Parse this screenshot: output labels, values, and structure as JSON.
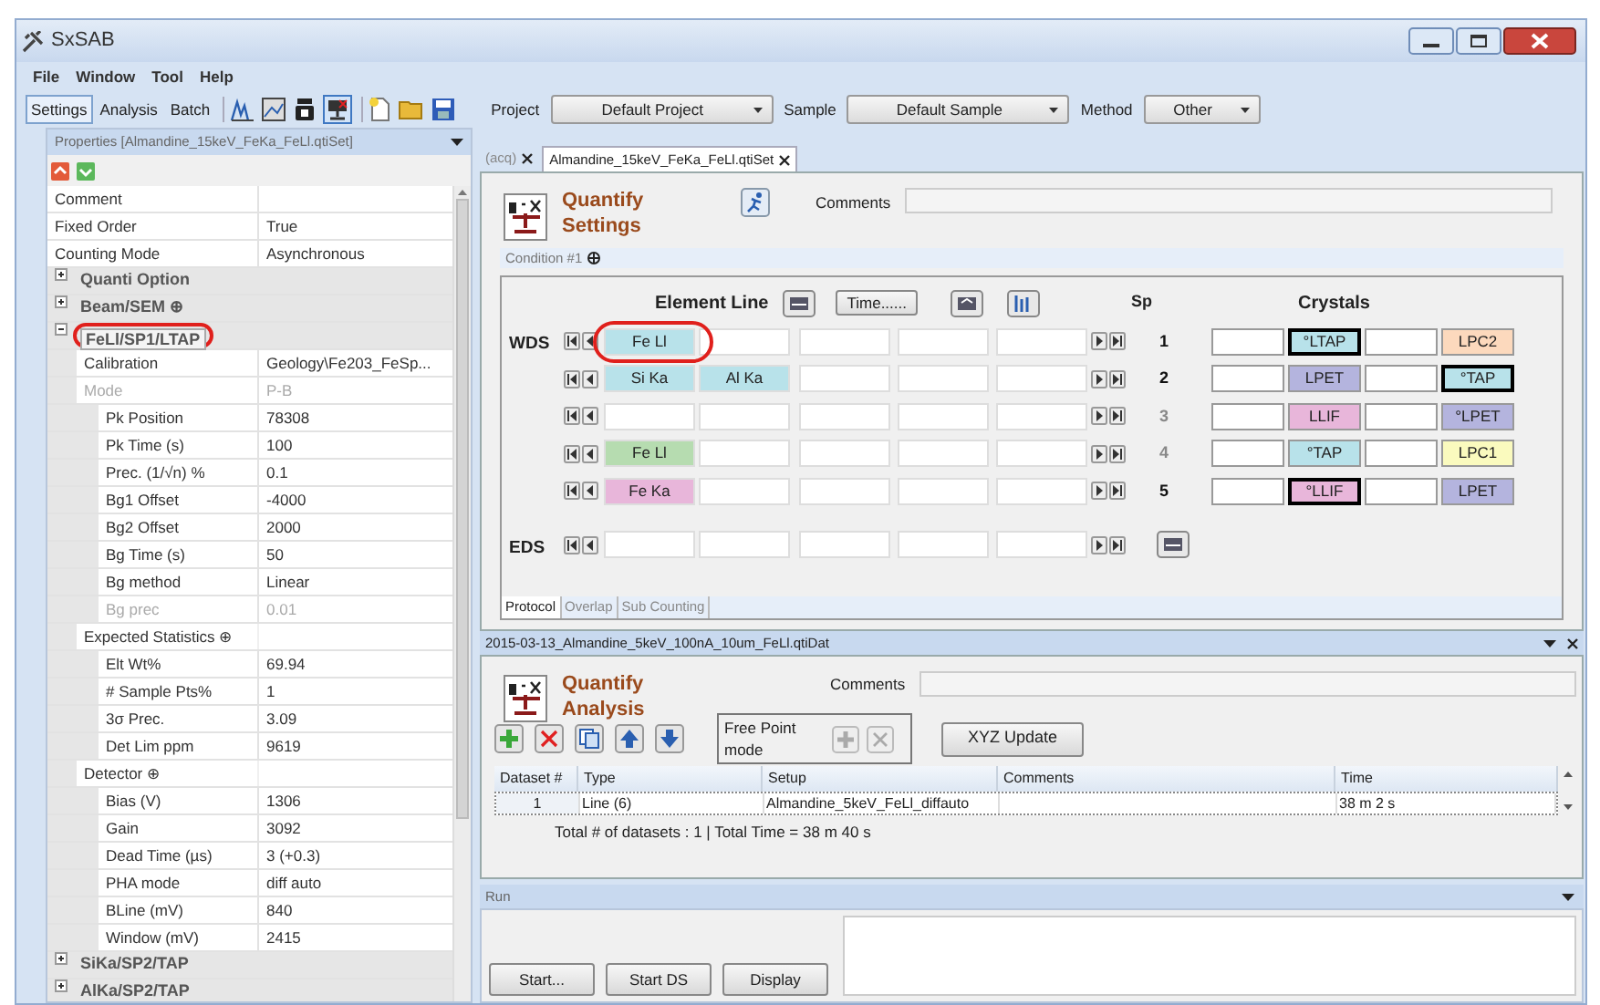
{
  "window": {
    "title": "SxSAB"
  },
  "menu": [
    "File",
    "Window",
    "Tool",
    "Help"
  ],
  "toolbar": {
    "modes": [
      {
        "label": "Settings",
        "selected": true
      },
      {
        "label": "Analysis",
        "selected": false
      },
      {
        "label": "Batch",
        "selected": false
      }
    ],
    "selectors": [
      {
        "label": "Project",
        "value": "Default Project"
      },
      {
        "label": "Sample",
        "value": "Default Sample"
      },
      {
        "label": "Method",
        "value": "Other"
      }
    ]
  },
  "properties": {
    "title": "Properties [Almandine_15keV_FeKa_FeLl.qtiSet]",
    "rows": [
      {
        "kind": "field",
        "name": "Comment",
        "disabled": false
      },
      {
        "kind": "field",
        "name": "Fixed Order",
        "value": "True",
        "disabled": false
      },
      {
        "kind": "field",
        "name": "Counting Mode",
        "value": "Asynchronous",
        "disabled": false
      },
      {
        "kind": "category",
        "name": "Quanti  Option",
        "expanded": false,
        "highlighted": false
      },
      {
        "kind": "category",
        "name": "Beam/SEM ⊕",
        "expanded": false,
        "highlighted": false
      },
      {
        "kind": "category",
        "name": "FeLl/SP1/LTAP",
        "expanded": true,
        "highlighted": true,
        "children": [
          {
            "kind": "field",
            "name": "Calibration",
            "value": "Geology\\Fe203_FeSp...",
            "disabled": false
          },
          {
            "kind": "field",
            "name": "Mode",
            "value": "P-B",
            "disabled": true,
            "children": [
              {
                "kind": "field",
                "name": "Pk Position",
                "value": "78308",
                "disabled": false
              },
              {
                "kind": "field",
                "name": "Pk Time (s)",
                "value": "100",
                "disabled": false
              },
              {
                "kind": "field",
                "name": "Prec. (1/√n) %",
                "value": "0.1",
                "disabled": false
              },
              {
                "kind": "field",
                "name": "Bg1 Offset",
                "value": "-4000",
                "disabled": false
              },
              {
                "kind": "field",
                "name": "Bg2 Offset",
                "value": "2000",
                "disabled": false
              },
              {
                "kind": "field",
                "name": "Bg Time (s)",
                "value": "50",
                "disabled": false
              },
              {
                "kind": "field",
                "name": "Bg method",
                "value": "Linear",
                "disabled": false
              },
              {
                "kind": "field",
                "name": "Bg prec",
                "value": "0.01",
                "disabled": true
              }
            ]
          },
          {
            "kind": "subgroup",
            "name": "Expected Statistics ⊕",
            "children": [
              {
                "kind": "field",
                "name": "Elt Wt%",
                "value": "69.94",
                "disabled": false
              },
              {
                "kind": "field",
                "name": "# Sample Pts%",
                "value": "1",
                "disabled": false
              },
              {
                "kind": "field",
                "name": "3σ Prec.",
                "value": "3.09",
                "disabled": false
              },
              {
                "kind": "field",
                "name": "Det Lim ppm",
                "value": "9619",
                "disabled": false
              }
            ]
          },
          {
            "kind": "subgroup",
            "name": "Detector ⊕",
            "children": [
              {
                "kind": "field",
                "name": "Bias (V)",
                "value": "1306",
                "disabled": false
              },
              {
                "kind": "field",
                "name": "Gain",
                "value": "3092",
                "disabled": false
              },
              {
                "kind": "field",
                "name": "Dead Time (µs)",
                "value": "3 (+0.3)",
                "disabled": false
              },
              {
                "kind": "field",
                "name": "PHA mode",
                "value": "diff auto",
                "disabled": false
              },
              {
                "kind": "field",
                "name": "BLine (mV)",
                "value": "840",
                "disabled": false
              },
              {
                "kind": "field",
                "name": "Window (mV)",
                "value": "2415",
                "disabled": false
              }
            ]
          }
        ]
      },
      {
        "kind": "category",
        "name": "SiKa/SP2/TAP",
        "expanded": false,
        "highlighted": false
      },
      {
        "kind": "category",
        "name": "AlKa/SP2/TAP",
        "expanded": false,
        "highlighted": false
      }
    ]
  },
  "document_tabs": [
    {
      "label": "(acq)",
      "selected": false
    },
    {
      "label": "Almandine_15keV_FeKa_FeLl.qtiSet",
      "selected": true
    }
  ],
  "settings": {
    "heading": "Quantify Settings",
    "comments_label": "Comments",
    "condition": "Condition #1",
    "element_lines": {
      "heading": "Element Line",
      "time_button": "Time......",
      "sp_heading": "Sp",
      "crystals_heading": "Crystals",
      "rows": [
        {
          "kind": "wds",
          "label": "WDS",
          "spectrometer": "1",
          "active": true,
          "elements": [
            {
              "label": "Fe Ll",
              "color": "#b8e2ea",
              "highlighted": true
            }
          ],
          "crystals": [
            {
              "label": "°LTAP",
              "color": "#b8e2ea",
              "selected": true
            },
            {
              "label": "LPC2",
              "color": "#fcd9bd",
              "selected": false
            }
          ]
        },
        {
          "kind": "wds",
          "spectrometer": "2",
          "active": true,
          "elements": [
            {
              "label": "Si Ka",
              "color": "#b8e2ea",
              "highlighted": false
            },
            {
              "label": "Al Ka",
              "color": "#b8e2ea",
              "highlighted": false
            }
          ],
          "crystals": [
            {
              "label": "LPET",
              "color": "#b4b4de",
              "selected": false
            },
            {
              "label": "°TAP",
              "color": "#b8e2ea",
              "selected": true
            }
          ]
        },
        {
          "kind": "wds",
          "spectrometer": "3",
          "active": false,
          "elements": [],
          "crystals": [
            {
              "label": "LLIF",
              "color": "#e8b6da",
              "selected": false
            },
            {
              "label": "°LPET",
              "color": "#b4b4de",
              "selected": false
            }
          ]
        },
        {
          "kind": "wds",
          "spectrometer": "4",
          "active": false,
          "elements": [
            {
              "label": "Fe Ll",
              "color": "#b6dcb0",
              "highlighted": false
            }
          ],
          "crystals": [
            {
              "label": "°TAP",
              "color": "#b8e2ea",
              "selected": false
            },
            {
              "label": "LPC1",
              "color": "#fafabe",
              "selected": false
            }
          ]
        },
        {
          "kind": "wds",
          "spectrometer": "5",
          "active": true,
          "elements": [
            {
              "label": "Fe Ka",
              "color": "#e8b6da",
              "highlighted": false
            }
          ],
          "crystals": [
            {
              "label": "°LLIF",
              "color": "#e8b6da",
              "selected": true
            },
            {
              "label": "LPET",
              "color": "#b4b4de",
              "selected": false
            }
          ]
        },
        {
          "kind": "eds",
          "label": "EDS"
        }
      ]
    },
    "tabs": [
      {
        "label": "Protocol",
        "selected": true
      },
      {
        "label": "Overlap",
        "selected": false
      },
      {
        "label": "Sub Counting",
        "selected": false
      }
    ]
  },
  "analysis": {
    "title": "2015-03-13_Almandine_5keV_100nA_10um_FeLl.qtiDat",
    "heading": "Quantify Analysis",
    "comments_label": "Comments",
    "free_point_label": "Free Point mode",
    "xyz_button": "XYZ Update",
    "table": {
      "columns": [
        "Dataset #",
        "Type",
        "Setup",
        "Comments",
        "Time"
      ],
      "rows": [
        {
          "cells": [
            "1",
            "Line (6)",
            "Almandine_5keV_FeLl_diffauto",
            null,
            "38 m 2 s"
          ]
        }
      ]
    },
    "summary": "Total # of datasets : 1  | Total Time = 38 m 40 s"
  },
  "run": {
    "title": "Run",
    "buttons": [
      "Start...",
      "Start DS",
      "Display"
    ]
  }
}
